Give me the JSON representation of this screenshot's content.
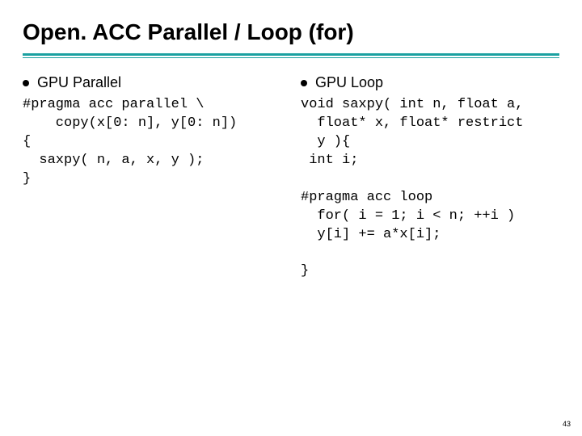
{
  "title": "Open. ACC Parallel / Loop (for)",
  "left": {
    "heading": "GPU Parallel",
    "code": "#pragma acc parallel \\\n    copy(x[0: n], y[0: n])\n{\n  saxpy( n, a, x, y );\n}"
  },
  "right": {
    "heading": "GPU Loop",
    "code": "void saxpy( int n, float a,\n  float* x, float* restrict\n  y ){\n int i;\n\n#pragma acc loop\n  for( i = 1; i < n; ++i )\n  y[i] += a*x[i];\n\n}"
  },
  "page_number": "43"
}
